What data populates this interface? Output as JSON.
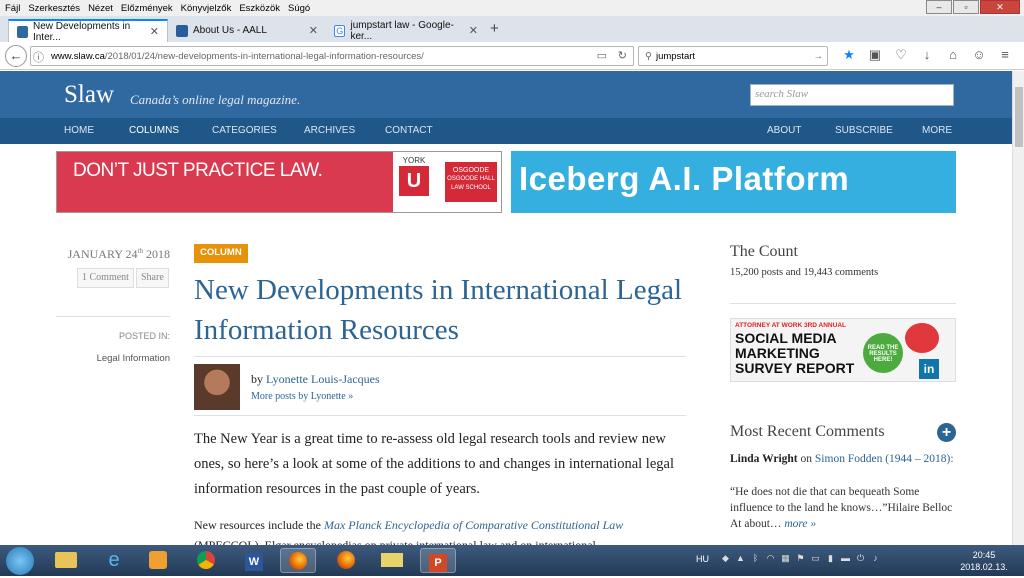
{
  "menu": [
    "Fájl",
    "Szerkesztés",
    "Nézet",
    "Előzmények",
    "Könyvjelzők",
    "Eszközök",
    "Súgó"
  ],
  "tabs": [
    {
      "label": "New Developments in Inter...",
      "active": true,
      "icon_color": "#2f69a0"
    },
    {
      "label": "About Us - AALL",
      "active": false,
      "icon_color": "#2a5d9a"
    },
    {
      "label": "jumpstart law - Google-ker...",
      "active": false,
      "icon_color": "#4285f4"
    }
  ],
  "url": {
    "domain": "www.slaw.ca",
    "path": "/2018/01/24/new-developments-in-international-legal-information-resources/"
  },
  "browser_search": "jumpstart",
  "site": {
    "logo": "Slaw",
    "tagline": "Canada’s online legal magazine.",
    "search_placeholder": "search Slaw",
    "nav_left": [
      "HOME",
      "COLUMNS",
      "CATEGORIES",
      "ARCHIVES",
      "CONTACT"
    ],
    "nav_right": [
      "ABOUT",
      "SUBSCRIBE",
      "MORE"
    ]
  },
  "ads": {
    "york": {
      "text": "DON’T JUST PRACTICE LAW.",
      "york": "YORK",
      "u": "U",
      "osgoode": "OSGOODE",
      "osgoode_sub": "OSGOODE HALL LAW SCHOOL"
    },
    "iceberg": "Iceberg A.I. Platform",
    "social": {
      "small": "ATTORNEY AT WORK 3RD ANNUAL",
      "line1": "SOCIAL MEDIA",
      "line2": "MARKETING",
      "line3": "SURVEY REPORT",
      "cta": "READ THE RESULTS HERE!",
      "li": "in"
    }
  },
  "article": {
    "month": "JANUARY 24",
    "suffix": "th",
    "year": " 2018",
    "comments": "1 Comment",
    "share": "Share",
    "posted_in_label": "POSTED IN:",
    "category": "Legal Information",
    "badge": "COLUMN",
    "title": "New Developments in International Legal Information Resources",
    "by_prefix": "by ",
    "author": "Lyonette Louis-Jacques",
    "more_posts": "More posts by Lyonette »",
    "lead": "The New Year is a great time to re-assess old legal research tools and review new ones, so here’s a look at some of the additions to and changes in international legal information resources in the past couple of years.",
    "para2_prefix": "New resources include the ",
    "para2_link": "Max Planck Encyclopedia of Comparative Constitutional Law",
    "para2_rest": " (MPECCOL), Elgar encyclopedias on private international law and on international"
  },
  "sidebar": {
    "count_title": "The Count",
    "count_text": "15,200 posts and 19,443 comments",
    "recent_title": "Most Recent Comments",
    "plus": "+",
    "commenter": "Linda Wright",
    "on": " on ",
    "post": "Simon Fodden (1944 – 2018):",
    "quote": "“He does not die that can bequeath Some influence to the land he knows…”Hilaire Belloc At about… ",
    "more": "more »"
  },
  "taskbar": {
    "lang": "HU",
    "time": "20:45",
    "date": "2018.02.13."
  }
}
